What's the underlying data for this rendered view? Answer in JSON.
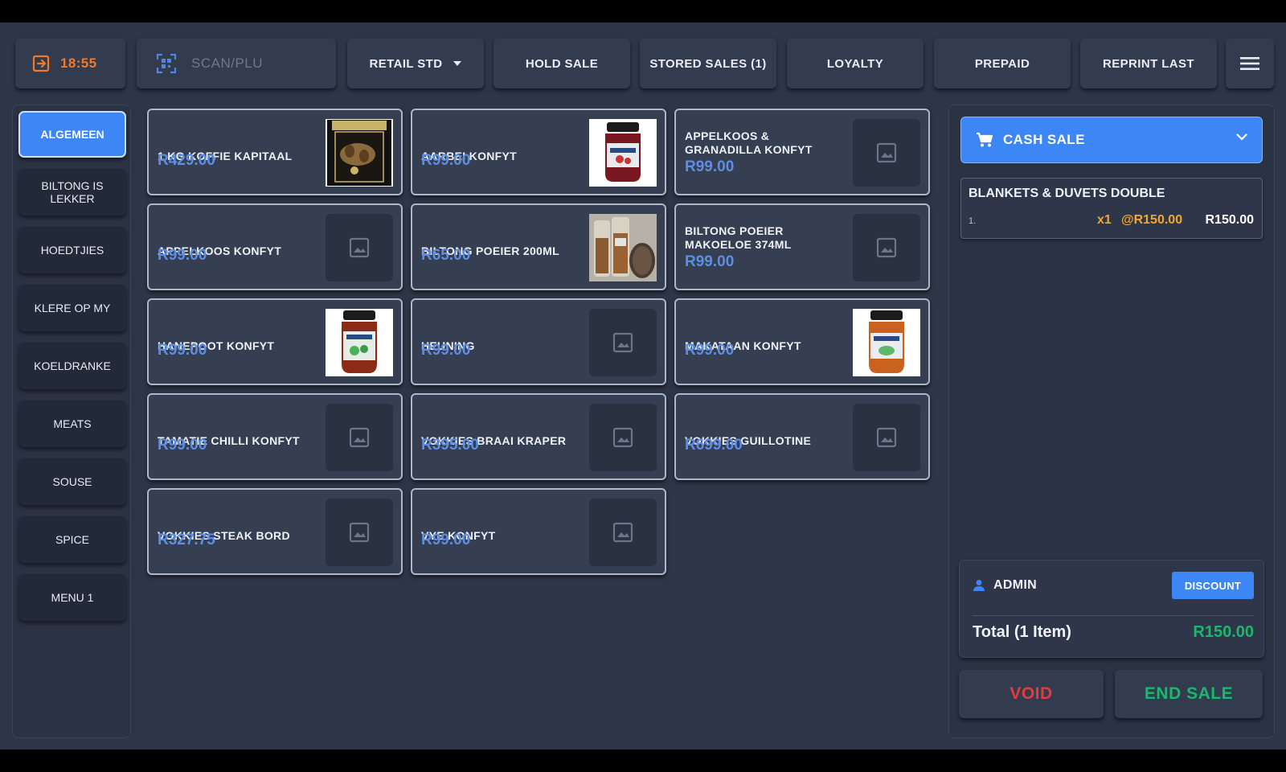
{
  "topbar": {
    "clock": "18:55",
    "scan_placeholder": "SCAN/PLU",
    "price_list": "RETAIL STD",
    "hold_sale": "HOLD SALE",
    "stored_sales": "STORED SALES (1)",
    "loyalty": "LOYALTY",
    "prepaid": "PREPAID",
    "reprint_last": "REPRINT LAST"
  },
  "categories": [
    {
      "label": "ALGEMEEN",
      "active": true
    },
    {
      "label": "BILTONG IS LEKKER",
      "active": false
    },
    {
      "label": "HOEDTJIES",
      "active": false
    },
    {
      "label": "KLERE OP MY",
      "active": false
    },
    {
      "label": "KOELDRANKE",
      "active": false
    },
    {
      "label": "MEATS",
      "active": false
    },
    {
      "label": "SOUSE",
      "active": false
    },
    {
      "label": "SPICE",
      "active": false
    },
    {
      "label": "MENU 1",
      "active": false
    }
  ],
  "products": [
    {
      "name": "1 KG KOFFIE KAPITAAL",
      "price": "R429.00",
      "image": "photo-coffee-bag"
    },
    {
      "name": "AARBEI KONFYT",
      "price": "R99.00",
      "image": "photo-jam-jar-red"
    },
    {
      "name": "APPELKOOS & GRANADILLA KONFYT",
      "price": "R99.00",
      "image": "placeholder"
    },
    {
      "name": "APPELKOOS KONFYT",
      "price": "R99.00",
      "image": "placeholder"
    },
    {
      "name": "BILTONG POEIER 200ML",
      "price": "R65.00",
      "image": "photo-biltong-powder"
    },
    {
      "name": "BILTONG POEIER MAKOELOE 374ML",
      "price": "R99.00",
      "image": "placeholder"
    },
    {
      "name": "HANEPOOT KONFYT",
      "price": "R99.00",
      "image": "photo-jam-jar-green"
    },
    {
      "name": "HEUNING",
      "price": "R99.00",
      "image": "placeholder"
    },
    {
      "name": "MAKATAAN KONFYT",
      "price": "R99.00",
      "image": "photo-jam-jar-orange"
    },
    {
      "name": "TAMATIE CHILLI KONFYT",
      "price": "R99.00",
      "image": "placeholder"
    },
    {
      "name": "VOKKIES BRAAI KRAPER",
      "price": "R395.00",
      "image": "placeholder"
    },
    {
      "name": "VOKKIES GUILLOTINE",
      "price": "R699.00",
      "image": "placeholder"
    },
    {
      "name": "VOKKIES STEAK BORD",
      "price": "R327.75",
      "image": "placeholder"
    },
    {
      "name": "VYE KONFYT",
      "price": "R99.00",
      "image": "placeholder"
    }
  ],
  "sale": {
    "type": "CASH SALE",
    "lines": [
      {
        "index": "1.",
        "name": "BLANKETS & DUVETS DOUBLE",
        "qty": "x1",
        "unit_price": "@R150.00",
        "total": "R150.00"
      }
    ],
    "user": "ADMIN",
    "discount_label": "DISCOUNT",
    "total_label": "Total (1 Item)",
    "total_value": "R150.00",
    "void_label": "VOID",
    "end_sale_label": "END SALE"
  },
  "colors": {
    "accent": "#3d86f5",
    "clock": "#f07a2c",
    "price": "#5d8ee6",
    "qty": "#f0a732",
    "total": "#19b86c",
    "void": "#e43b3b"
  }
}
